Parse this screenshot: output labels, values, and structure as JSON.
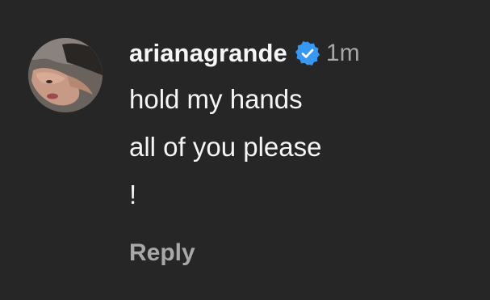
{
  "comment": {
    "username": "arianagrande",
    "verified_icon": "verified-badge-icon",
    "verified_color": "#3897f0",
    "timestamp": "1m",
    "text": "hold my hands\nall of you please\n!",
    "reply_label": "Reply"
  },
  "colors": {
    "background": "#262626",
    "primary_text": "#f5f5f5",
    "secondary_text": "#a8a8a8"
  }
}
